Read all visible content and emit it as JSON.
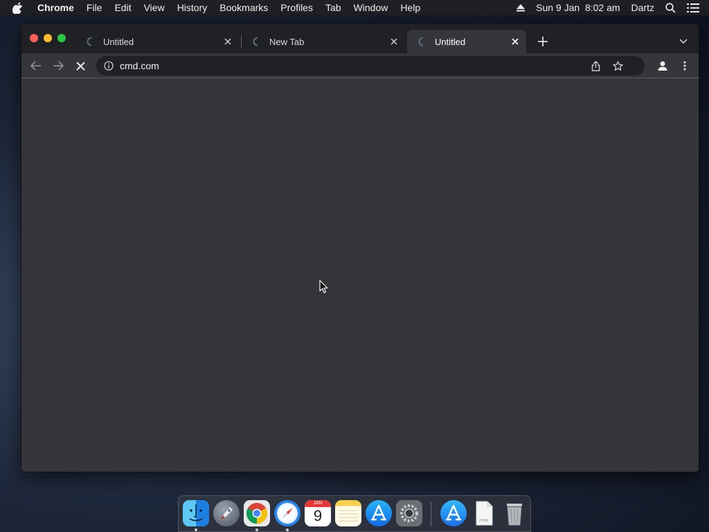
{
  "menubar": {
    "app_name": "Chrome",
    "menus": [
      "File",
      "Edit",
      "View",
      "History",
      "Bookmarks",
      "Profiles",
      "Tab",
      "Window",
      "Help"
    ],
    "datetime": "Sun 9 Jan  8:02 am",
    "user": "Dartz",
    "status_icons": [
      "eject-icon",
      "spotlight-search-icon",
      "control-center-icon"
    ]
  },
  "browser": {
    "tabs": [
      {
        "title": "Untitled",
        "loading": true,
        "active": false
      },
      {
        "title": "New Tab",
        "loading": true,
        "active": false
      },
      {
        "title": "Untitled",
        "loading": true,
        "active": true
      }
    ],
    "omnibox": {
      "url": "cmd.com"
    },
    "toolbar_icons": [
      "back-icon",
      "forward-icon",
      "stop-loading-icon",
      "site-info-icon",
      "share-icon",
      "bookmark-star-icon",
      "profile-icon",
      "menu-kebab-icon"
    ]
  },
  "dock": {
    "apps": [
      {
        "name": "Finder",
        "running": true
      },
      {
        "name": "Launchpad",
        "running": false
      },
      {
        "name": "Google Chrome",
        "running": true
      },
      {
        "name": "Safari",
        "running": true
      },
      {
        "name": "Calendar",
        "running": false,
        "label": "JAN",
        "day": "9"
      },
      {
        "name": "Notes",
        "running": false
      },
      {
        "name": "App Store",
        "running": false
      },
      {
        "name": "System Preferences",
        "running": false
      }
    ],
    "others": [
      {
        "name": "Applications"
      },
      {
        "name": "HTML Document",
        "label": "HTML"
      },
      {
        "name": "Trash"
      }
    ]
  },
  "colors": {
    "menubar": "#1f2024",
    "tabstrip": "#202124",
    "toolbar": "#35363a",
    "omnibox": "#202124",
    "content": "#35363a"
  }
}
